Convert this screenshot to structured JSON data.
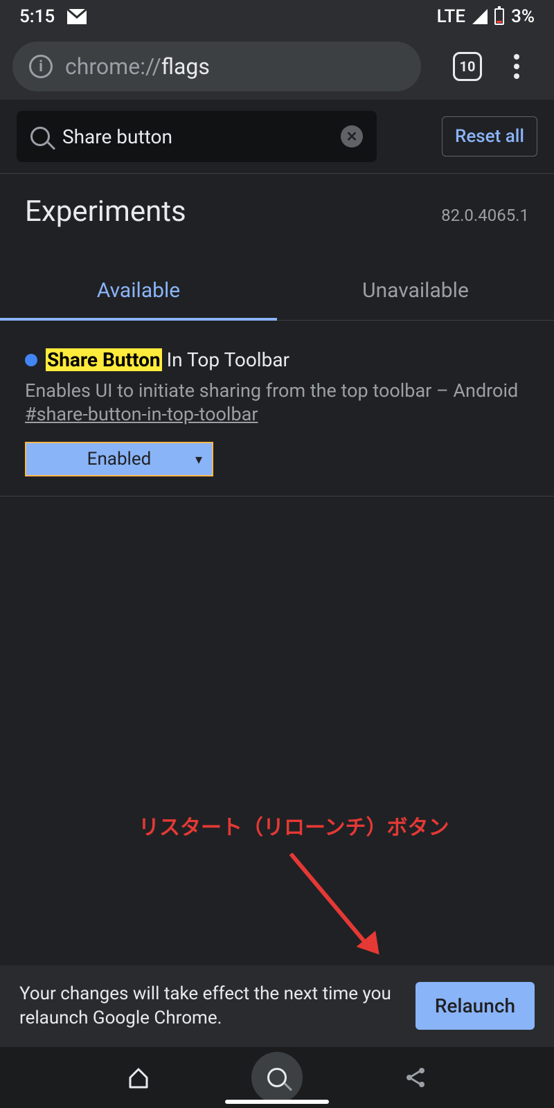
{
  "status": {
    "time": "5:15",
    "network": "LTE",
    "battery": "3%"
  },
  "toolbar": {
    "url_prefix": "chrome://",
    "url_page": "flags",
    "tab_count": "10"
  },
  "search": {
    "value": "Share button",
    "reset_label": "Reset all"
  },
  "header": {
    "title": "Experiments",
    "version": "82.0.4065.1"
  },
  "tabs": {
    "available": "Available",
    "unavailable": "Unavailable"
  },
  "flag": {
    "highlight": "Share Button",
    "title_rest": " In Top Toolbar",
    "description": "Enables UI to initiate sharing from the top toolbar – Android",
    "hash": "#share-button-in-top-toolbar",
    "select_value": "Enabled"
  },
  "annotation": {
    "text": "リスタート（リローンチ）ボタン"
  },
  "relaunch": {
    "message": "Your changes will take effect the next time you relaunch Google Chrome.",
    "button": "Relaunch"
  }
}
